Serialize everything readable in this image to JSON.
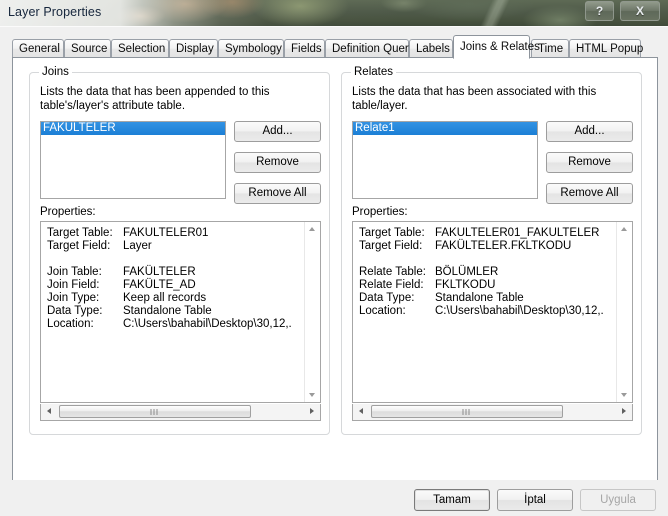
{
  "window": {
    "title": "Layer Properties",
    "help_label": "?",
    "close_label": "X"
  },
  "tabs": [
    {
      "label": "General",
      "active": false
    },
    {
      "label": "Source",
      "active": false
    },
    {
      "label": "Selection",
      "active": false
    },
    {
      "label": "Display",
      "active": false
    },
    {
      "label": "Symbology",
      "active": false
    },
    {
      "label": "Fields",
      "active": false
    },
    {
      "label": "Definition Query",
      "active": false
    },
    {
      "label": "Labels",
      "active": false
    },
    {
      "label": "Joins & Relates",
      "active": true
    },
    {
      "label": "Time",
      "active": false
    },
    {
      "label": "HTML Popup",
      "active": false
    }
  ],
  "joins": {
    "caption": "Joins",
    "description": "Lists the data that has been appended to this table's/layer's attribute table.",
    "list": [
      "FAKÜLTELER"
    ],
    "selected": "FAKÜLTELER",
    "buttons": {
      "add": "Add...",
      "remove": "Remove",
      "remove_all": "Remove All"
    },
    "properties_label": "Properties:",
    "properties": [
      {
        "key": "Target Table:",
        "value": "FAKÜLTELER01"
      },
      {
        "key": "Target Field:",
        "value": "Layer"
      },
      {
        "key": "",
        "value": ""
      },
      {
        "key": "Join Table:",
        "value": "FAKÜLTELER"
      },
      {
        "key": "Join Field:",
        "value": "FAKÜLTE_AD"
      },
      {
        "key": "Join Type:",
        "value": "Keep all records"
      },
      {
        "key": "Data Type:",
        "value": "Standalone Table"
      },
      {
        "key": "Location:",
        "value": "C:\\Users\\bahabil\\Desktop\\30,12,."
      }
    ]
  },
  "relates": {
    "caption": "Relates",
    "description": "Lists the data that has been associated with this table/layer.",
    "list": [
      "Relate1"
    ],
    "selected": "Relate1",
    "buttons": {
      "add": "Add...",
      "remove": "Remove",
      "remove_all": "Remove All"
    },
    "properties_label": "Properties:",
    "properties": [
      {
        "key": "Target Table:",
        "value": "FAKÜLTELER01_FAKÜLTELER"
      },
      {
        "key": "Target Field:",
        "value": "FAKÜLTELER.FKLTKODU"
      },
      {
        "key": "",
        "value": ""
      },
      {
        "key": "Relate Table:",
        "value": "BÖLÜMLER"
      },
      {
        "key": "Relate Field:",
        "value": "FKLTKODU"
      },
      {
        "key": "Data Type:",
        "value": "Standalone Table"
      },
      {
        "key": "Location:",
        "value": "C:\\Users\\bahabil\\Desktop\\30,12,."
      }
    ]
  },
  "footer": {
    "ok": "Tamam",
    "cancel": "İptal",
    "apply": "Uygula",
    "apply_disabled": true
  },
  "colors": {
    "selection_blue": "#1b7fd6",
    "dialog_face": "#f0f0f0",
    "page_white": "#ffffff",
    "border_gray": "#8d949c"
  }
}
